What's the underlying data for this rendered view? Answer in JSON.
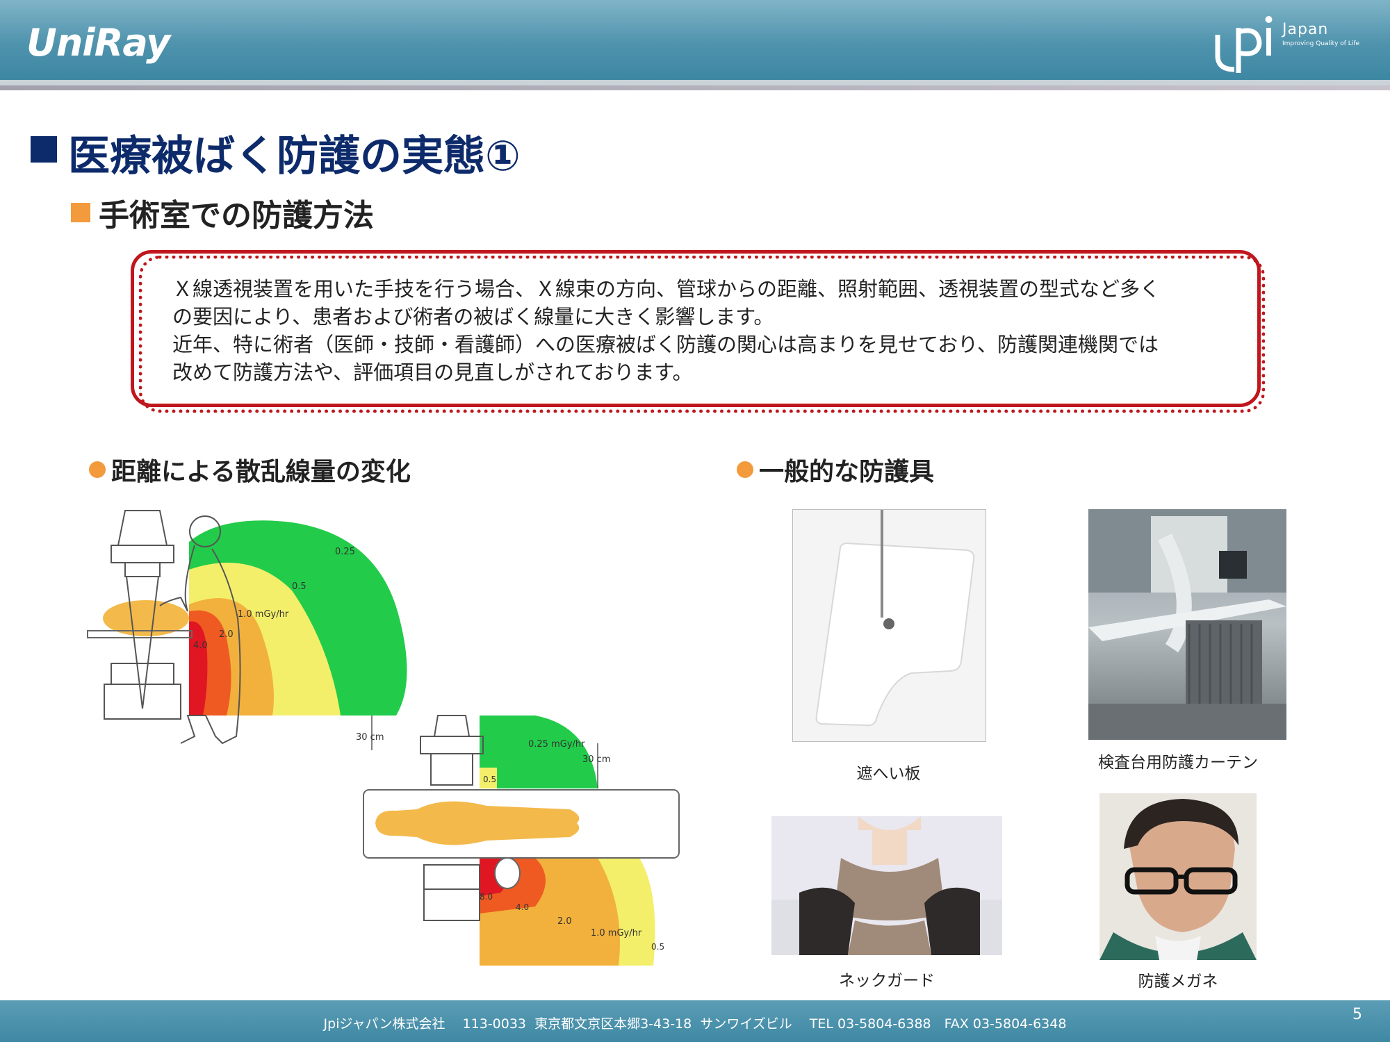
{
  "header": {
    "left_logo": "UniRay",
    "right_logo_mark": "Jpi",
    "right_logo_word": "Japan",
    "right_logo_tagline": "Improving Quality of Life"
  },
  "title": "医療被ばく防護の実態①",
  "subtitle": "手術室での防護方法",
  "callout": {
    "line1": "Ｘ線透視装置を用いた手技を行う場合、Ｘ線束の方向、管球からの距離、照射範囲、透視装置の型式など多く",
    "line2": "の要因により、患者および術者の被ばく線量に大きく影響します。",
    "line3": "近年、特に術者（医師・技師・看護師）への医療被ばく防護の関心は高まりを見せており、防護関連機関では",
    "line4": "改めて防護方法や、評価項目の見直しがされております。"
  },
  "left_section": {
    "title": "距離による散乱線量の変化",
    "side_view_labels": {
      "l025": "0.25",
      "l05": "0.5",
      "l10": "1.0 mGy/hr",
      "l20": "2.0",
      "l40": "4.0",
      "dist": "30 cm"
    },
    "top_view_labels": {
      "l025": "0.25 mGy/hr",
      "l05": "0.5",
      "dist": "30 cm",
      "l80": "8.0",
      "l40": "4.0",
      "l20": "2.0",
      "l10": "1.0 mGy/hr",
      "l05b": "0.5"
    },
    "colors": {
      "green": "#22cc4a",
      "yellow": "#f3ef6a",
      "orange": "#f2b13c",
      "red_orange": "#ee5a22",
      "red": "#e01622",
      "body": "#f3b94a"
    }
  },
  "right_section": {
    "title": "一般的な防護具",
    "items": [
      {
        "caption": "遮へい板"
      },
      {
        "caption": "検査台用防護カーテン"
      },
      {
        "caption": "ネックガード"
      },
      {
        "caption": "防護メガネ"
      }
    ]
  },
  "footer": {
    "text": "Jpiジャパン株式会社　 113-0033  東京都文京区本郷3-43-18  サンワイズビル　 TEL 03-5804-6388　FAX 03-5804-6348",
    "page_number": "5"
  },
  "colors": {
    "title_navy": "#0d2b6b",
    "accent_orange": "#f29a3c",
    "callout_red": "#c0161d",
    "header_teal": "#4f93ad"
  }
}
